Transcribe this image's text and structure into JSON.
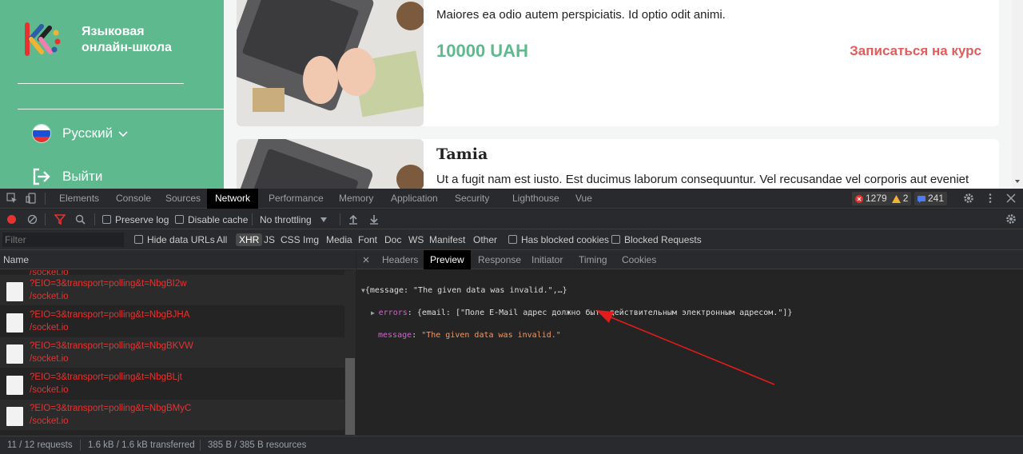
{
  "sidebar": {
    "school_name_line1": "Языковая",
    "school_name_line2": "онлайн-школа",
    "language_label": "Русский",
    "logout_label": "Выйти"
  },
  "courses": [
    {
      "title": "",
      "description": "Maiores ea odio autem perspiciatis. Id optio odit animi.",
      "price": "10000 UAH",
      "enroll_label": "Записаться на курс"
    },
    {
      "title": "Tamia",
      "description": "Ut a fugit nam est iusto. Est ducimus laborum consequuntur. Vel recusandae vel corporis aut eveniet"
    }
  ],
  "devtools": {
    "tabs": [
      "Elements",
      "Console",
      "Sources",
      "Network",
      "Performance",
      "Memory",
      "Application",
      "Security",
      "Lighthouse",
      "Vue"
    ],
    "active_tab": "Network",
    "error_count": "1279",
    "warning_count": "2",
    "message_count": "241",
    "toolbar": {
      "preserve_log": "Preserve log",
      "disable_cache": "Disable cache",
      "throttling": "No throttling"
    },
    "filter_bar": {
      "filter_placeholder": "Filter",
      "hide_data_urls": "Hide data URLs",
      "types": [
        "All",
        "XHR",
        "JS",
        "CSS",
        "Img",
        "Media",
        "Font",
        "Doc",
        "WS",
        "Manifest",
        "Other"
      ],
      "active_type": "XHR",
      "has_blocked_cookies": "Has blocked cookies",
      "blocked_requests": "Blocked Requests"
    },
    "requests_header": "Name",
    "requests": [
      {
        "name": "?EIO=3&transport=polling&t=NbgBI2w",
        "path": "/socket.io"
      },
      {
        "name": "?EIO=3&transport=polling&t=NbgBJHA",
        "path": "/socket.io"
      },
      {
        "name": "?EIO=3&transport=polling&t=NbgBKVW",
        "path": "/socket.io"
      },
      {
        "name": "?EIO=3&transport=polling&t=NbgBLjt",
        "path": "/socket.io"
      },
      {
        "name": "?EIO=3&transport=polling&t=NbgBMyC",
        "path": "/socket.io"
      }
    ],
    "partial_row_path": "/socket.io",
    "preview_tabs": [
      "Headers",
      "Preview",
      "Response",
      "Initiator",
      "Timing",
      "Cookies"
    ],
    "active_preview_tab": "Preview",
    "json_preview": {
      "summary": "{message: \"The given data was invalid.\",…}",
      "errors_key": "errors",
      "errors_value": "{email: [\"Поле E-Mail адрес должно быть действительным электронным адресом.\"]}",
      "message_key": "message",
      "message_value": "\"The given data was invalid.\""
    },
    "status": {
      "requests": "11 / 12 requests",
      "transferred": "1.6 kB / 1.6 kB transferred",
      "resources": "385 B / 385 B resources"
    }
  },
  "colors": {
    "brand_green": "#5eb98e",
    "enroll_red": "#e05d5d",
    "error_red": "#e8322f",
    "annotation_arrow": "#e31b1b"
  }
}
